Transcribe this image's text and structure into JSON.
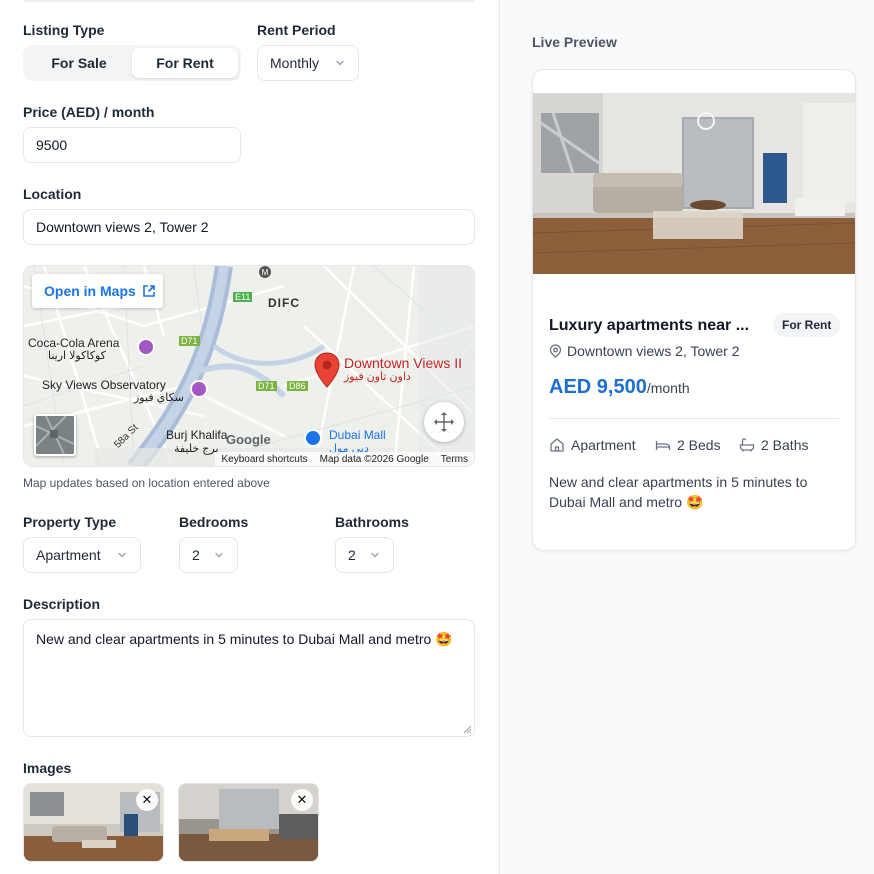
{
  "form": {
    "listing_type_label": "Listing Type",
    "listing_type_options": [
      "For Sale",
      "For Rent"
    ],
    "listing_type_selected": "For Rent",
    "rent_period_label": "Rent Period",
    "rent_period_value": "Monthly",
    "price_label": "Price (AED) / month",
    "price_value": "9500",
    "location_label": "Location",
    "location_value": "Downtown views 2, Tower 2",
    "map": {
      "open_in_maps": "Open in Maps",
      "labels": {
        "difc": "DIFC",
        "coca_cola": "Coca-Cola Arena",
        "coca_cola_ar": "كوكاكولا ارينا",
        "sky_views": "Sky Views Observatory",
        "sky_views_ar": "سكاي فيوز",
        "downtown_views": "Downtown Views II",
        "downtown_views_ar": "داون تاون فيوز",
        "burj": "Burj Khalifa",
        "burj_ar": "برج خليفة",
        "dubai_mall": "Dubai Mall",
        "dubai_mall_ar": "دبي مول",
        "google": "Google",
        "road_58a": "58a St",
        "road_e11": "E11",
        "road_d71a": "D71",
        "road_d71b": "D71",
        "road_d86": "D86",
        "metro": "M"
      },
      "footer": [
        "Keyboard shortcuts",
        "Map data ©2026 Google",
        "Terms"
      ]
    },
    "map_note": "Map updates based on location entered above",
    "property_type_label": "Property Type",
    "property_type_value": "Apartment",
    "bedrooms_label": "Bedrooms",
    "bedrooms_value": "2",
    "bathrooms_label": "Bathrooms",
    "bathrooms_value": "2",
    "description_label": "Description",
    "description_value": "New and clear apartments in 5 minutes to Dubai Mall and metro 🤩",
    "images_label": "Images",
    "remove_symbol": "✕"
  },
  "preview": {
    "heading": "Live Preview",
    "title": "Luxury apartments near ...",
    "badge": "For Rent",
    "location": "Downtown views 2, Tower 2",
    "price_amount": "AED 9,500",
    "price_period": "/month",
    "features": {
      "type": "Apartment",
      "beds": "2 Beds",
      "baths": "2 Baths"
    },
    "description": "New and clear apartments in 5 minutes to Dubai Mall and metro 🤩"
  },
  "colors": {
    "accent_blue": "#1d6fd1",
    "map_link": "#1a73e8",
    "map_pin": "#ea4335"
  },
  "icons": [
    "chevron-down-icon",
    "external-link-icon",
    "map-pin-icon",
    "home-icon",
    "bed-icon",
    "bath-icon",
    "expand-icon",
    "close-icon"
  ]
}
